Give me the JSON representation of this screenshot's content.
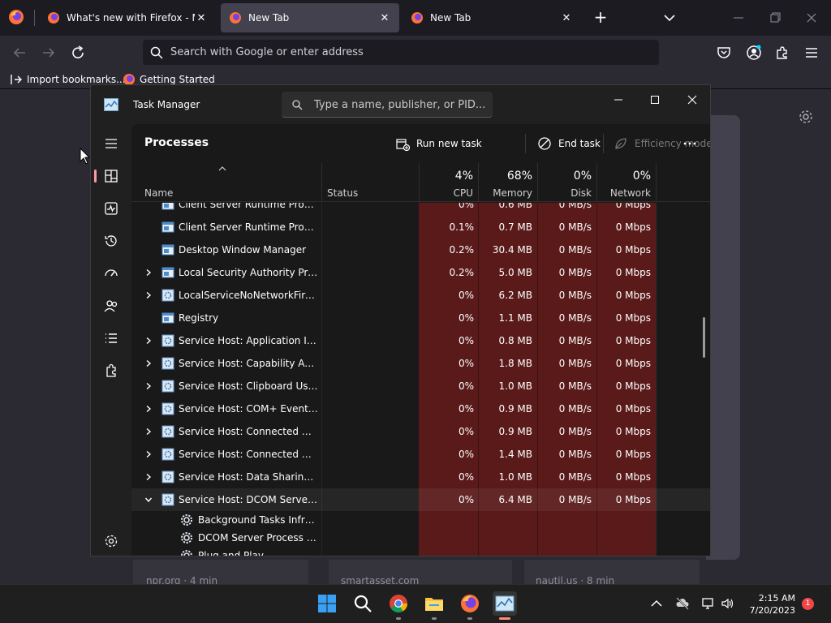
{
  "browser": {
    "tabs": [
      {
        "title": "What's new with Firefox - More",
        "active": false
      },
      {
        "title": "New Tab",
        "active": true
      },
      {
        "title": "New Tab",
        "active": false
      }
    ],
    "urlbar_placeholder": "Search with Google or enter address",
    "bookmarks": [
      {
        "label": "Import bookmarks..."
      },
      {
        "label": "Getting Started"
      }
    ],
    "stories": [
      {
        "source": "npr.org · 4 min"
      },
      {
        "source": "smartasset.com"
      },
      {
        "source": "nautil.us · 8 min"
      }
    ]
  },
  "task_manager": {
    "title": "Task Manager",
    "search_placeholder": "Type a name, publisher, or PID...",
    "page_title": "Processes",
    "toolbar": {
      "run_new_task": "Run new task",
      "end_task": "End task",
      "efficiency_mode": "Efficiency mode"
    },
    "columns": {
      "name": "Name",
      "status": "Status",
      "cpu": {
        "label": "CPU",
        "pct": "4%"
      },
      "memory": {
        "label": "Memory",
        "pct": "68%"
      },
      "disk": {
        "label": "Disk",
        "pct": "0%"
      },
      "network": {
        "label": "Network",
        "pct": "0%"
      }
    },
    "rows": [
      {
        "name": "Client Server Runtime Process",
        "expand": "",
        "icon": "window",
        "cpu": "0%",
        "mem": "0.6 MB",
        "disk": "0 MB/s",
        "net": "0 Mbps"
      },
      {
        "name": "Client Server Runtime Process",
        "expand": "",
        "icon": "window",
        "cpu": "0.1%",
        "mem": "0.7 MB",
        "disk": "0 MB/s",
        "net": "0 Mbps"
      },
      {
        "name": "Desktop Window Manager",
        "expand": "",
        "icon": "window",
        "cpu": "0.2%",
        "mem": "30.4 MB",
        "disk": "0 MB/s",
        "net": "0 Mbps"
      },
      {
        "name": "Local Security Authority Proce...",
        "expand": "collapsed",
        "icon": "window",
        "cpu": "0.2%",
        "mem": "5.0 MB",
        "disk": "0 MB/s",
        "net": "0 Mbps"
      },
      {
        "name": "LocalServiceNoNetworkFirewa...",
        "expand": "collapsed",
        "icon": "service",
        "cpu": "0%",
        "mem": "6.2 MB",
        "disk": "0 MB/s",
        "net": "0 Mbps"
      },
      {
        "name": "Registry",
        "expand": "",
        "icon": "window",
        "cpu": "0%",
        "mem": "1.1 MB",
        "disk": "0 MB/s",
        "net": "0 Mbps"
      },
      {
        "name": "Service Host: Application Infor...",
        "expand": "collapsed",
        "icon": "service",
        "cpu": "0%",
        "mem": "0.8 MB",
        "disk": "0 MB/s",
        "net": "0 Mbps"
      },
      {
        "name": "Service Host: Capability Acces...",
        "expand": "collapsed",
        "icon": "service",
        "cpu": "0%",
        "mem": "1.8 MB",
        "disk": "0 MB/s",
        "net": "0 Mbps"
      },
      {
        "name": "Service Host: Clipboard User S...",
        "expand": "collapsed",
        "icon": "service",
        "cpu": "0%",
        "mem": "1.0 MB",
        "disk": "0 MB/s",
        "net": "0 Mbps"
      },
      {
        "name": "Service Host: COM+ Event Sys...",
        "expand": "collapsed",
        "icon": "service",
        "cpu": "0%",
        "mem": "0.9 MB",
        "disk": "0 MB/s",
        "net": "0 Mbps"
      },
      {
        "name": "Service Host: Connected Devi...",
        "expand": "collapsed",
        "icon": "service",
        "cpu": "0%",
        "mem": "0.9 MB",
        "disk": "0 MB/s",
        "net": "0 Mbps"
      },
      {
        "name": "Service Host: Connected Devi...",
        "expand": "collapsed",
        "icon": "service",
        "cpu": "0%",
        "mem": "1.4 MB",
        "disk": "0 MB/s",
        "net": "0 Mbps"
      },
      {
        "name": "Service Host: Data Sharing Ser...",
        "expand": "collapsed",
        "icon": "service",
        "cpu": "0%",
        "mem": "1.0 MB",
        "disk": "0 MB/s",
        "net": "0 Mbps"
      },
      {
        "name": "Service Host: DCOM Server Pr...",
        "expand": "expanded",
        "icon": "service",
        "cpu": "0%",
        "mem": "6.4 MB",
        "disk": "0 MB/s",
        "net": "0 Mbps",
        "selected": true
      },
      {
        "name": "Background Tasks Infrastr...",
        "sub": true,
        "icon": "gear",
        "cpu": "",
        "mem": "",
        "disk": "",
        "net": ""
      },
      {
        "name": "DCOM Server Process Lau...",
        "sub": true,
        "icon": "gear",
        "cpu": "",
        "mem": "",
        "disk": "",
        "net": ""
      },
      {
        "name": "Plug and Play",
        "sub": true,
        "icon": "gear",
        "cpu": "",
        "mem": "",
        "disk": "",
        "net": ""
      }
    ]
  },
  "taskbar": {
    "time": "2:15 AM",
    "date": "7/20/2023",
    "notifications": "1"
  },
  "colors": {
    "heatmap": "#5a1a1a",
    "accent_nav": "#ff99a4",
    "firefox_orange": "#ff7139"
  }
}
